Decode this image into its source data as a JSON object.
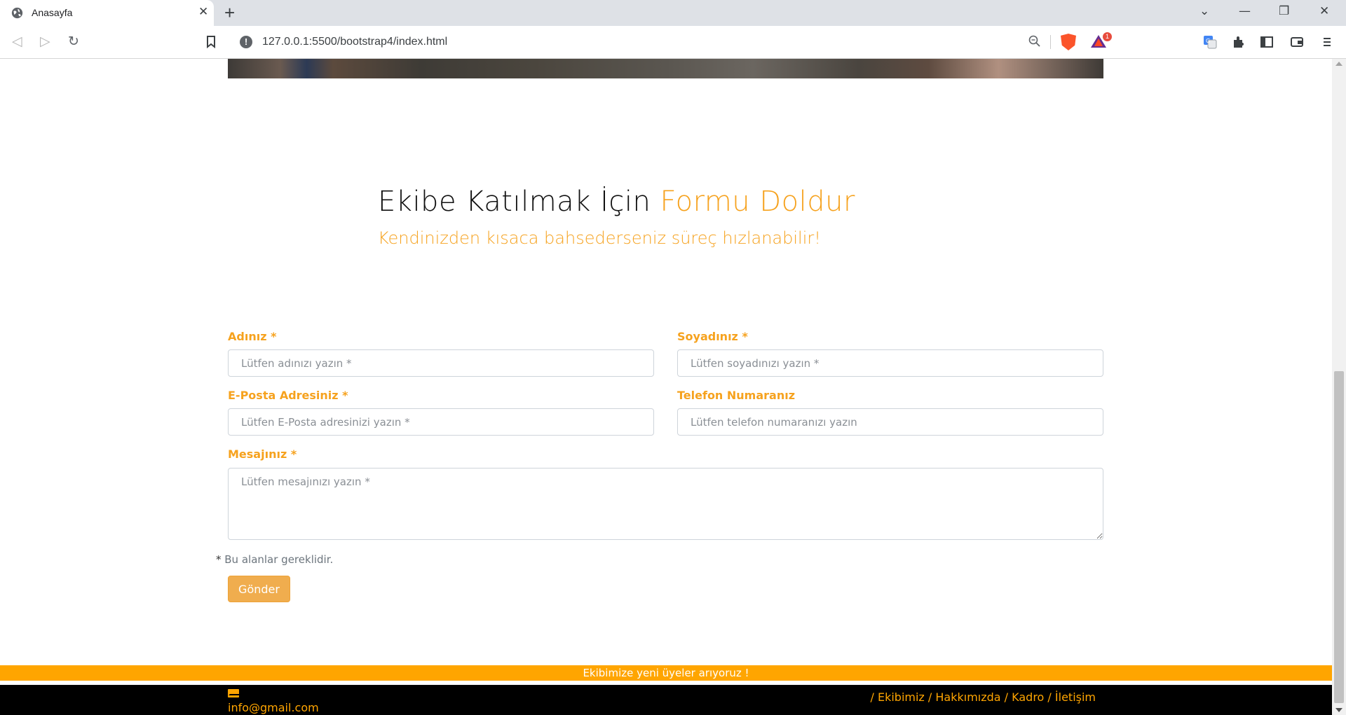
{
  "browser": {
    "tab_title": "Anasayfa",
    "tab_close": "✕",
    "new_tab": "+",
    "url": "127.0.0.1:5500/bootstrap4/index.html",
    "notification_count": "1",
    "window_controls": {
      "dropdown": "⌄",
      "minimize": "—",
      "restore": "❐",
      "close": "✕"
    },
    "nav": {
      "back": "◁",
      "forward": "▷",
      "reload": "↻"
    }
  },
  "form_section": {
    "heading_main": "Ekibe Katılmak İçin ",
    "heading_accent": "Formu Doldur",
    "subheading": "Kendinizden kısaca bahsederseniz süreç hızlanabilir!",
    "first_name": {
      "label": "Adınız *",
      "placeholder": "Lütfen adınızı yazın *"
    },
    "last_name": {
      "label": "Soyadınız *",
      "placeholder": "Lütfen soyadınızı yazın *"
    },
    "email": {
      "label": "E-Posta Adresiniz *",
      "placeholder": "Lütfen E-Posta adresinizi yazın *"
    },
    "phone": {
      "label": "Telefon Numaranız",
      "placeholder": "Lütfen telefon numaranızı yazın"
    },
    "message": {
      "label": "Mesajınız *",
      "placeholder": "Lütfen mesajınızı yazın *"
    },
    "required_star": "*",
    "required_note": " Bu alanlar gereklidir.",
    "submit_label": "Gönder"
  },
  "announcement": "Ekibimize yeni üyeler arıyoruz !",
  "footer": {
    "email": "info@gmail.com",
    "nav_items": [
      "Ekibimiz",
      "Hakkımızda",
      "Kadro",
      "İletişim"
    ],
    "separator": " / "
  },
  "colors": {
    "accent": "#f6a21e",
    "button": "#f0ad4e",
    "announcement_bg": "#ffa500",
    "footer_bg": "#000000"
  },
  "icons": [
    "globe-icon",
    "close-icon",
    "plus-icon",
    "back-icon",
    "forward-icon",
    "reload-icon",
    "bookmark-icon",
    "info-icon",
    "zoom-icon",
    "brave-shield-icon",
    "brave-rewards-icon",
    "translate-icon",
    "extensions-icon",
    "sidebar-icon",
    "wallet-icon",
    "menu-icon",
    "envelope-icon"
  ]
}
